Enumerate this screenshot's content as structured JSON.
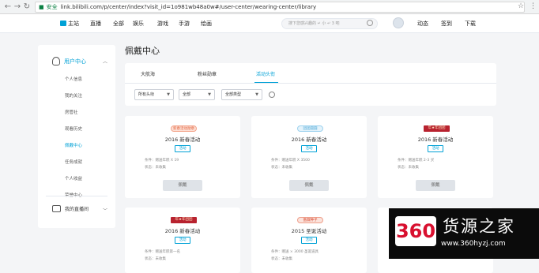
{
  "browser": {
    "secure_label": "安全",
    "url": "link.bilibili.com/p/center/index?visit_id=1o981wb48a0w#/user-center/wearing-center/library"
  },
  "header": {
    "nav": [
      "主站",
      "直播",
      "全部",
      "娱乐",
      "游戏",
      "手游",
      "绘画"
    ],
    "search_placeholder": "搜下您感兴趣的 ↵ 小 ↵ 3 吧",
    "right_links": [
      "动态",
      "签到",
      "下载"
    ]
  },
  "sidebar": {
    "section_title": "用户中心",
    "items": [
      "个人信息",
      "我的关注",
      "房管社",
      "观看历史",
      "佩戴中心",
      "任务成就",
      "个人收益",
      "荣誉中心"
    ],
    "active_item": "佩戴中心",
    "live_title": "我的直播间"
  },
  "page": {
    "title": "佩戴中心",
    "tabs": [
      "大航海",
      "粉丝勋章",
      "活动头衔"
    ],
    "active_tab": "活动头衔",
    "filters": [
      "所有头衔",
      "全部",
      "全部类型"
    ]
  },
  "cards": [
    {
      "badge": "新春活动勋章",
      "title": "2016 新春活动",
      "tag": "活动",
      "condition": "条件：赠送年糕 X 19",
      "status": "状态：未收集",
      "button": "佩戴"
    },
    {
      "badge": "团团圆圆",
      "title": "2016 新春活动",
      "tag": "活动",
      "condition": "条件：赠送年糕 X 3500",
      "status": "状态：未收集",
      "button": "佩戴"
    },
    {
      "badge": "年★年团团",
      "title": "2016 新春活动",
      "tag": "活动",
      "condition": "条件：赠送年糕 2-3 买",
      "status": "状态：未收集",
      "button": "佩戴"
    },
    {
      "badge": "年★年团团",
      "title": "2016 新春活动",
      "tag": "活动",
      "condition": "条件：赠送年糕第一名",
      "status": "状态：未收集",
      "button": "佩戴"
    },
    {
      "badge": "蔷薇种子",
      "title": "2015 圣诞活动",
      "tag": "活动",
      "condition": "条件：赠送 × 3000 圣诞道具",
      "status": "状态：未收集",
      "button": "佩戴"
    },
    {
      "badge": "",
      "title": "",
      "tag": "",
      "condition": "",
      "status": "",
      "button": ""
    }
  ],
  "watermark": {
    "logo": "360",
    "brand": "货源之家",
    "url": "www.360hyzj.com"
  },
  "colors": {
    "accent": "#00a1d6",
    "watermark_red": "#d8102f"
  }
}
